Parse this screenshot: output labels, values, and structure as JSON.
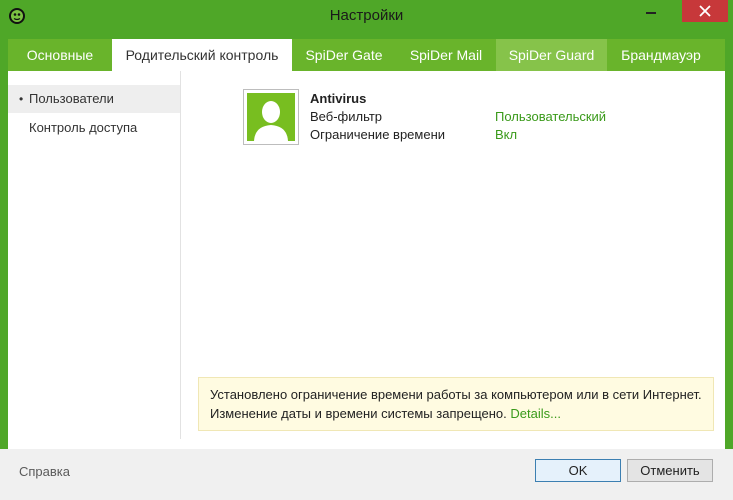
{
  "window": {
    "title": "Настройки"
  },
  "tabs": [
    {
      "label": "Основные"
    },
    {
      "label": "Родительский контроль"
    },
    {
      "label": "SpiDer Gate"
    },
    {
      "label": "SpiDer Mail"
    },
    {
      "label": "SpiDer Guard"
    },
    {
      "label": "Брандмауэр"
    }
  ],
  "sidebar": {
    "items": [
      {
        "label": "Пользователи",
        "bullet": "•"
      },
      {
        "label": "Контроль доступа"
      }
    ]
  },
  "user": {
    "name": "Antivirus",
    "props": [
      {
        "label": "Веб-фильтр",
        "value": "Пользовательский"
      },
      {
        "label": "Ограничение времени",
        "value": "Вкл"
      }
    ]
  },
  "notice": {
    "line1": "Установлено ограничение времени работы за компьютером или в сети Интернет.",
    "line2": "Изменение даты и времени системы запрещено.",
    "link": "Details..."
  },
  "footer": {
    "help": "Справка",
    "ok": "OK",
    "cancel": "Отменить"
  },
  "colors": {
    "brand_green": "#4fa728",
    "tab_green": "#69b42b",
    "link_green": "#3a9a1a",
    "avatar_green": "#78be20",
    "close_red": "#c7383a"
  }
}
